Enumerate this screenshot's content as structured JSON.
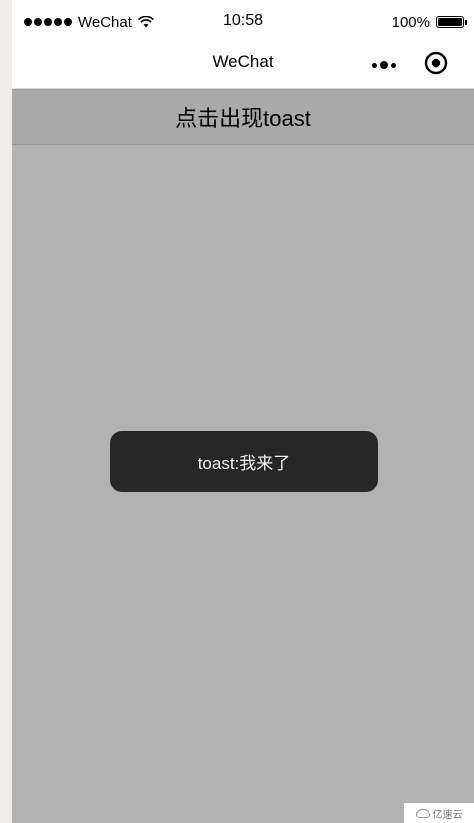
{
  "status_bar": {
    "carrier": "WeChat",
    "time": "10:58",
    "battery_percent": "100%",
    "icons": [
      "signal-dots-icon",
      "wifi-icon",
      "battery-icon"
    ]
  },
  "nav_bar": {
    "title": "WeChat",
    "icons": [
      "more-icon",
      "close-capsule-icon"
    ]
  },
  "main": {
    "button_label": "点击出现toast"
  },
  "toast": {
    "message": "toast:我来了"
  },
  "watermark": {
    "text": "亿速云"
  },
  "colors": {
    "background": "#b2b2b2",
    "button_background": "#a9a9a9",
    "toast_background": "#262626",
    "toast_text": "#f2f2f2",
    "bar_background": "#ffffff"
  }
}
